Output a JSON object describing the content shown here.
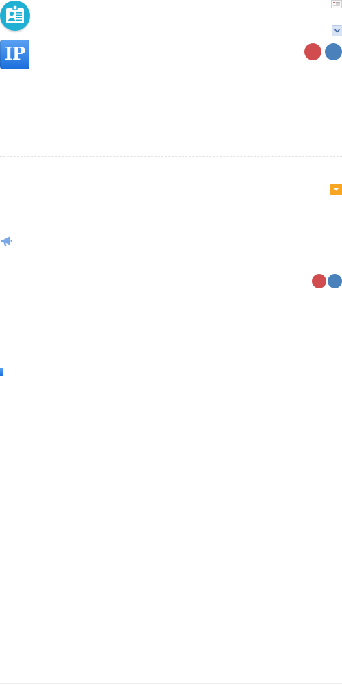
{
  "icons": {
    "id_card": "id-card-icon",
    "small_card": "contact-card-icon",
    "chevron": "chevron-down-icon",
    "ip": "ip-icon",
    "orange_dropdown": "caret-down-icon",
    "megaphone": "megaphone-icon"
  },
  "ip_badge": {
    "label": "IP"
  },
  "colors": {
    "teal": "#1fb0d3",
    "blue": "#4b81bb",
    "red": "#d14c4f",
    "orange": "#f6a623",
    "ip_gradient_top": "#5aa1f3",
    "ip_gradient_bottom": "#1b6fdc"
  }
}
